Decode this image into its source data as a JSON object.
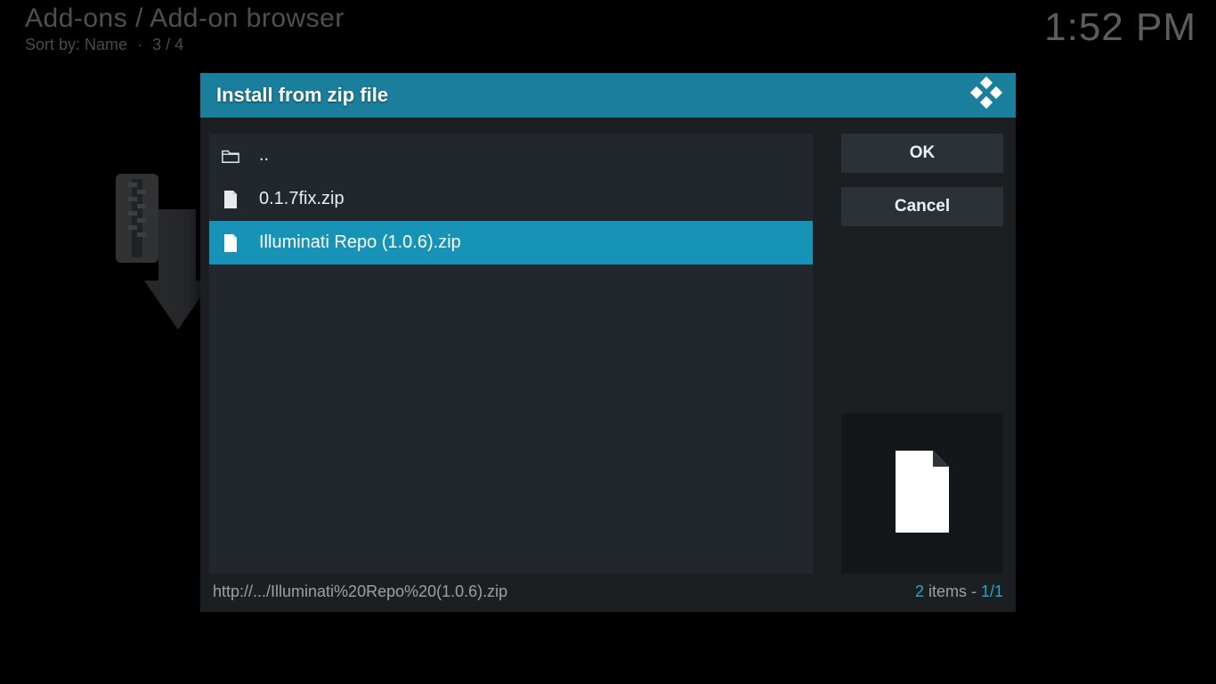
{
  "header": {
    "breadcrumb": "Add-ons / Add-on browser",
    "sort_label": "Sort by: Name",
    "index": "3 / 4",
    "clock": "1:52 PM"
  },
  "dialog": {
    "title": "Install from zip file",
    "ok_label": "OK",
    "cancel_label": "Cancel"
  },
  "files": {
    "parent_label": "..",
    "items": [
      {
        "name": "0.1.7fix.zip",
        "selected": false
      },
      {
        "name": "Illuminati Repo (1.0.6).zip",
        "selected": true
      }
    ]
  },
  "footer": {
    "path": "http://.../Illuminati%20Repo%20(1.0.6).zip",
    "count_num": "2",
    "count_word": " items - ",
    "page": "1/1"
  }
}
